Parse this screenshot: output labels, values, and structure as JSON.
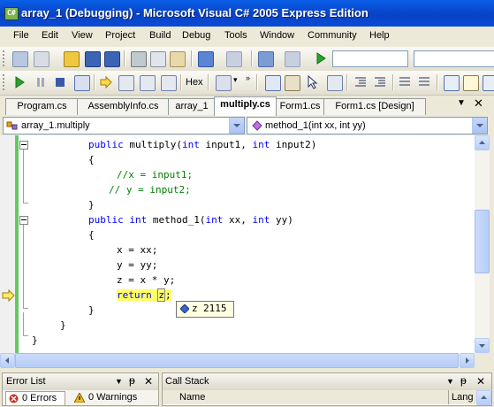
{
  "window": {
    "title": "array_1 (Debugging) - Microsoft Visual C# 2005 Express Edition",
    "app_icon_text": "C#"
  },
  "menu": [
    "File",
    "Edit",
    "View",
    "Project",
    "Build",
    "Debug",
    "Tools",
    "Window",
    "Community",
    "Help"
  ],
  "debug_toolbar": {
    "hex_label": "Hex"
  },
  "tabs": [
    "Program.cs",
    "AssemblyInfo.cs",
    "array_1",
    "multiply.cs",
    "Form1.cs",
    "Form1.cs [Design]"
  ],
  "active_tab": "multiply.cs",
  "nav": {
    "type_combo": "array_1.multiply",
    "member_combo": "method_1(int xx, int yy)"
  },
  "code": {
    "line1_kw1": "public",
    "line1_rest": " multiply(",
    "line1_kw2": "int",
    "line1_arg1": " input1, ",
    "line1_kw3": "int",
    "line1_arg2": " input2)",
    "open1": "{",
    "comment1": "//x = input1;",
    "comment2": "// y = input2;",
    "close1": "}",
    "line2_kw1": "public",
    "line2_kw2": "int",
    "line2_rest": " method_1(",
    "line2_kw3": "int",
    "line2_arg1": " xx, ",
    "line2_kw4": "int",
    "line2_arg2": " yy)",
    "open2": "{",
    "stmt1": "x = xx;",
    "stmt2": "y = yy;",
    "stmt3": "z = x * y;",
    "ret_kw": "return",
    "ret_var": "z",
    "ret_semi": ";",
    "close2": "}",
    "close3": "}",
    "close4": "}"
  },
  "datatip": {
    "name": "z",
    "value": "2115"
  },
  "error_list": {
    "title": "Error List",
    "errors": "0 Errors",
    "warnings": "0 Warnings",
    "pin": "ᵽ",
    "close": "✕"
  },
  "call_stack": {
    "title": "Call Stack",
    "col_name": "Name",
    "col_lang": "Lang"
  },
  "colors": {
    "keyword": "#0000ff",
    "comment": "#008000",
    "current_line": "#ffff66",
    "title_bar": "#0842c6"
  }
}
